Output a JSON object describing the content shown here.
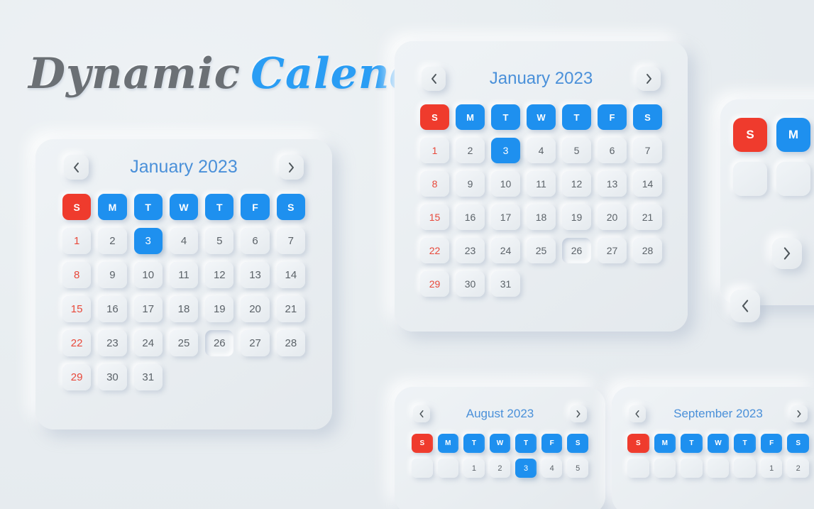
{
  "title": {
    "word1": "Dynamic",
    "word2": "Calendar",
    "color_gray": "#6b7075",
    "color_blue": "#2a9df4"
  },
  "theme": {
    "background": "#eaeff2",
    "accent_blue": "#1e90ef",
    "accent_red": "#ef3b2d",
    "month_title_color": "#4a90d9",
    "day_text_color": "#5b6268",
    "sunday_text_color": "#e8483a"
  },
  "icons": {
    "prev": "chevron-left-icon",
    "next": "chevron-right-icon"
  },
  "nav": {
    "prev_label": "‹",
    "next_label": "›"
  },
  "weekdays": [
    "S",
    "M",
    "T",
    "W",
    "T",
    "F",
    "S"
  ],
  "calendars": [
    {
      "id": "main",
      "month_title": "January 2023",
      "selected_day": 3,
      "pressed_day": 26,
      "leading_blanks": 0,
      "days": [
        1,
        2,
        3,
        4,
        5,
        6,
        7,
        8,
        9,
        10,
        11,
        12,
        13,
        14,
        15,
        16,
        17,
        18,
        19,
        20,
        21,
        22,
        23,
        24,
        25,
        26,
        27,
        28,
        29,
        30,
        31
      ]
    },
    {
      "id": "second",
      "month_title": "January 2023",
      "selected_day": 3,
      "pressed_day": 26,
      "leading_blanks": 0,
      "days": [
        1,
        2,
        3,
        4,
        5,
        6,
        7,
        8,
        9,
        10,
        11,
        12,
        13,
        14,
        15,
        16,
        17,
        18,
        19,
        20,
        21,
        22,
        23,
        24,
        25,
        26,
        27,
        28,
        29,
        30,
        31
      ]
    },
    {
      "id": "august",
      "month_title": "August 2023",
      "selected_day": 3,
      "pressed_day": null,
      "leading_blanks": 2,
      "days": [
        1,
        2,
        3,
        4,
        5
      ]
    },
    {
      "id": "september",
      "month_title": "September 2023",
      "selected_day": null,
      "pressed_day": null,
      "leading_blanks": 5,
      "days": [
        1,
        2
      ]
    },
    {
      "id": "partial",
      "month_title": "",
      "selected_day": null,
      "pressed_day": null,
      "leading_blanks": 0,
      "days": []
    }
  ],
  "floating_buttons": [
    {
      "name": "next",
      "label": "›"
    },
    {
      "name": "prev",
      "label": "‹"
    }
  ]
}
